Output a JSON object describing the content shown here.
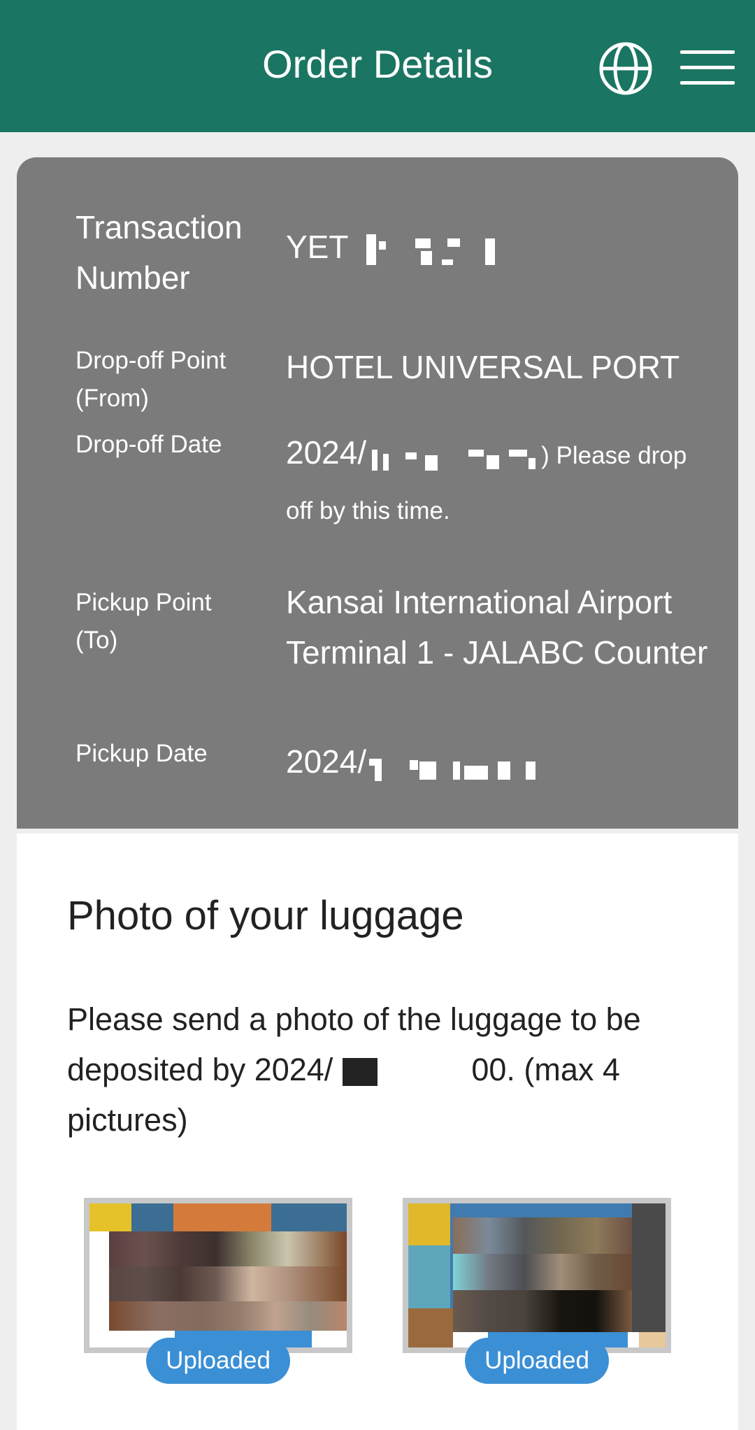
{
  "header": {
    "title": "Order Details",
    "language_icon": "globe-icon",
    "menu_icon": "hamburger-menu-icon",
    "background_color": "#1a7562"
  },
  "order": {
    "transaction_label": "Transaction Number",
    "transaction_prefix": "YET",
    "dropoff_point_label": "Drop-off Point (From)",
    "dropoff_point_value": "HOTEL UNIVERSAL PORT",
    "dropoff_date_label": "Drop-off Date",
    "dropoff_date_prefix": "2024/",
    "dropoff_date_suffix": ") Please drop off by this time.",
    "pickup_point_label": "Pickup Point (To)",
    "pickup_point_value": "Kansai International Airport Terminal 1 - JALABC Counter",
    "pickup_date_label": "Pickup Date",
    "pickup_date_prefix": "2024/"
  },
  "photos": {
    "title": "Photo of your luggage",
    "instructions_prefix": "Please send a photo of the luggage to be deposited by 2024/",
    "instructions_suffix": "00. (max 4 pictures)",
    "items": [
      {
        "status": "Uploaded"
      },
      {
        "status": "Uploaded"
      }
    ],
    "badge_color": "#3b8fd5"
  }
}
